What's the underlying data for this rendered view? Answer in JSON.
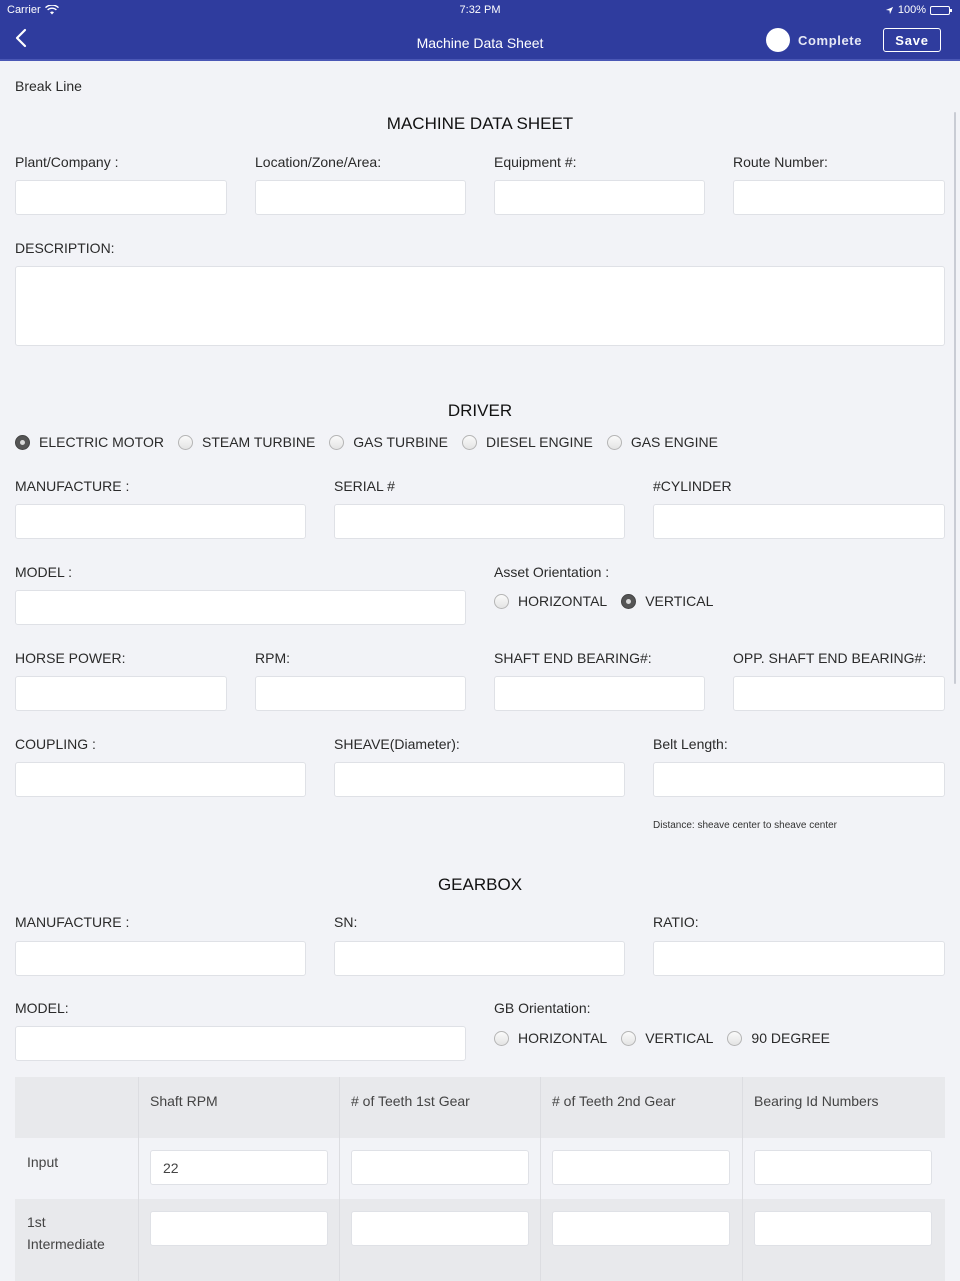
{
  "status_bar": {
    "carrier": "Carrier",
    "time": "7:32 PM",
    "battery": "100%"
  },
  "nav": {
    "title": "Machine Data Sheet",
    "complete_label": "Complete",
    "save_label": "Save",
    "complete_on": false
  },
  "break_line": "Break Line",
  "header_section": {
    "title": "MACHINE DATA SHEET",
    "fields": [
      {
        "label": "Plant/Company :",
        "value": ""
      },
      {
        "label": "Location/Zone/Area:",
        "value": ""
      },
      {
        "label": "Equipment #:",
        "value": ""
      },
      {
        "label": "Route Number:",
        "value": ""
      }
    ],
    "description_label": "DESCRIPTION:",
    "description_value": ""
  },
  "driver": {
    "title": "DRIVER",
    "types": [
      {
        "label": "ELECTRIC MOTOR",
        "selected": true
      },
      {
        "label": "STEAM TURBINE",
        "selected": false
      },
      {
        "label": "GAS TURBINE",
        "selected": false
      },
      {
        "label": "DIESEL ENGINE",
        "selected": false
      },
      {
        "label": "GAS ENGINE",
        "selected": false
      }
    ],
    "manufacture_label": "MANUFACTURE :",
    "serial_label": "SERIAL #",
    "cylinder_label": "#CYLINDER",
    "model_label": "MODEL :",
    "orientation_label": "Asset Orientation :",
    "orientation_options": [
      {
        "label": "HORIZONTAL",
        "selected": false
      },
      {
        "label": "VERTICAL",
        "selected": true
      }
    ],
    "horse_power_label": "HORSE POWER:",
    "rpm_label": "RPM:",
    "shaft_end_label": "SHAFT END BEARING#:",
    "opp_shaft_end_label": "OPP. SHAFT END BEARING#:",
    "coupling_label": "COUPLING :",
    "sheave_label": "SHEAVE(Diameter):",
    "belt_length_label": "Belt Length:",
    "belt_hint": "Distance: sheave center to sheave center"
  },
  "gearbox": {
    "title": "GEARBOX",
    "manufacture_label": "MANUFACTURE :",
    "sn_label": "SN:",
    "ratio_label": "RATIO:",
    "model_label": "MODEL:",
    "orientation_label": "GB Orientation:",
    "orientation_options": [
      {
        "label": "HORIZONTAL",
        "selected": false
      },
      {
        "label": "VERTICAL",
        "selected": false
      },
      {
        "label": "90 DEGREE",
        "selected": false
      }
    ],
    "table": {
      "columns": [
        "",
        "Shaft RPM",
        "# of Teeth 1st Gear",
        "# of Teeth 2nd Gear",
        "Bearing Id Numbers"
      ],
      "rows": [
        {
          "label": "Input",
          "values": [
            "22",
            "",
            "",
            ""
          ]
        },
        {
          "label": "1st\nIntermediate",
          "label_line1": "1st",
          "label_line2": "Intermediate",
          "values": [
            "",
            "",
            "",
            ""
          ]
        }
      ]
    }
  },
  "colors": {
    "nav_bg": "#2f3c9e",
    "page_bg": "#f2f3f7",
    "table_header_bg": "#e8e9ec"
  }
}
